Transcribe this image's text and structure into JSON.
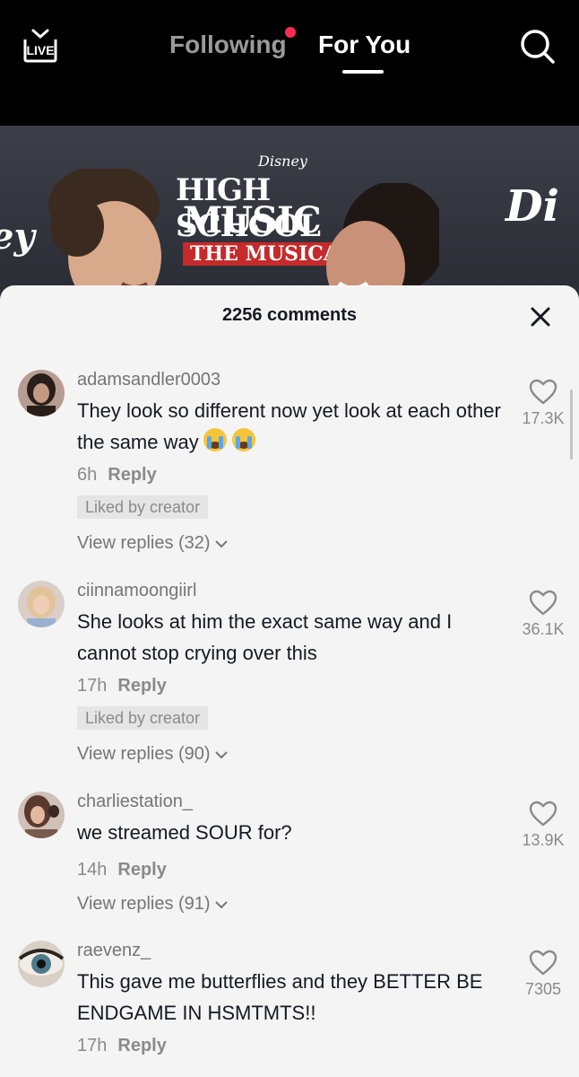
{
  "topbar": {
    "live_label": "LIVE",
    "tab_following": "Following",
    "tab_foryou": "For You"
  },
  "video": {
    "disney_small": "Disney",
    "logo_line1": "HIGH SCHOOL",
    "logo_line2": "MUSIC",
    "logo_line3": "THE MUSICAL",
    "disney_right": "Di",
    "disney_left": "ey"
  },
  "comments_panel": {
    "count_title": "2256 comments",
    "comments": [
      {
        "username": "adamsandler0003",
        "text": "They look so different now yet look at each other the same way",
        "time": "6h",
        "reply_label": "Reply",
        "liked_badge": "Liked by creator",
        "view_replies": "View replies (32)",
        "likes": "17.3K"
      },
      {
        "username": "ciinnamoongiirl",
        "text": "She looks at him the exact same way and I cannot stop crying over this",
        "time": "17h",
        "reply_label": "Reply",
        "liked_badge": "Liked by creator",
        "view_replies": "View replies (90)",
        "likes": "36.1K"
      },
      {
        "username": "charliestation_",
        "text": "we streamed SOUR for?",
        "time": "14h",
        "reply_label": "Reply",
        "view_replies": "View replies (91)",
        "likes": "13.9K"
      },
      {
        "username": "raevenz_",
        "text": "This gave me butterflies and they BETTER BE ENDGAME IN HSMTMTS!!",
        "time": "17h",
        "reply_label": "Reply",
        "likes": "7305"
      }
    ]
  },
  "icons": {
    "live": "live-tv-icon",
    "search": "search-icon",
    "close": "close-icon",
    "heart": "heart-outline-icon",
    "chevron": "chevron-down-icon",
    "emoji": "crying-face-emoji-icon"
  },
  "colors": {
    "accent_dot": "#fe2c55",
    "sheet_bg": "#f5f4f4",
    "text_primary": "#161823",
    "text_secondary": "#8a8a8a"
  }
}
